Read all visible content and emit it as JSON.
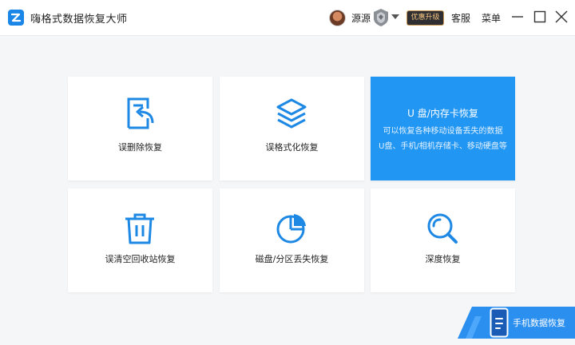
{
  "app": {
    "title": "嗨格式数据恢复大师",
    "logo_icon": "app-logo-icon"
  },
  "header": {
    "username": "源源",
    "upgrade_label": "优惠升级",
    "service_label": "客服",
    "menu_label": "菜单",
    "vip_icon": "vip-shield-icon"
  },
  "cards": [
    {
      "label": "误删除恢复",
      "icon": "undo-file-icon"
    },
    {
      "label": "误格式化恢复",
      "icon": "layers-icon"
    },
    {
      "title": "U 盘/内存卡恢复",
      "desc1": "可以恢复各种移动设备丢失的数据",
      "desc2": "U盘、手机/相机存储卡、移动硬盘等"
    },
    {
      "label": "误清空回收站恢复",
      "icon": "trash-icon"
    },
    {
      "label": "磁盘/分区丢失恢复",
      "icon": "pie-chart-icon"
    },
    {
      "label": "深度恢复",
      "icon": "search-icon"
    }
  ],
  "mobile": {
    "label": "手机数据恢复",
    "icon": "phone-icon"
  },
  "colors": {
    "accent": "#2196f3",
    "icon_blue": "#1e88e5"
  }
}
